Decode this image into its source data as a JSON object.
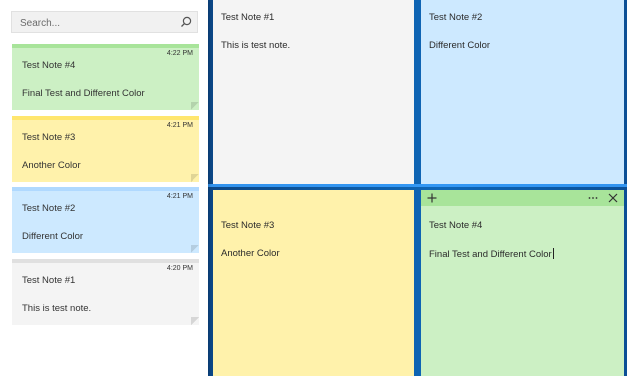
{
  "search": {
    "placeholder": "Search..."
  },
  "list": [
    {
      "title": "Test Note #4",
      "time": "4:22 PM",
      "body": "Final Test and Different Color"
    },
    {
      "title": "Test Note #3",
      "time": "4:21 PM",
      "body": "Another Color"
    },
    {
      "title": "Test Note #2",
      "time": "4:21 PM",
      "body": "Different Color"
    },
    {
      "title": "Test Note #1",
      "time": "4:20 PM",
      "body": "This is test note."
    }
  ],
  "notes": {
    "note1": {
      "title": "Test Note #1",
      "body": "This is test note."
    },
    "note2": {
      "title": "Test Note #2",
      "body": "Different Color"
    },
    "note3": {
      "title": "Test Note #3",
      "body": "Another Color"
    },
    "note4": {
      "title": "Test Note #4",
      "body": "Final Test and Different Color"
    }
  },
  "colors": {
    "green": "#ccf0c4",
    "green_band": "#a8e49a",
    "yellow": "#fff2ab",
    "yellow_band": "#ffe66e",
    "blue": "#cde9ff",
    "blue_band": "#b0d9ff",
    "gray": "#f4f4f4",
    "gray_band": "#e0e0e0"
  },
  "icons": {
    "search": "search-icon",
    "add": "plus-icon",
    "menu": "more-icon",
    "close": "close-icon"
  }
}
